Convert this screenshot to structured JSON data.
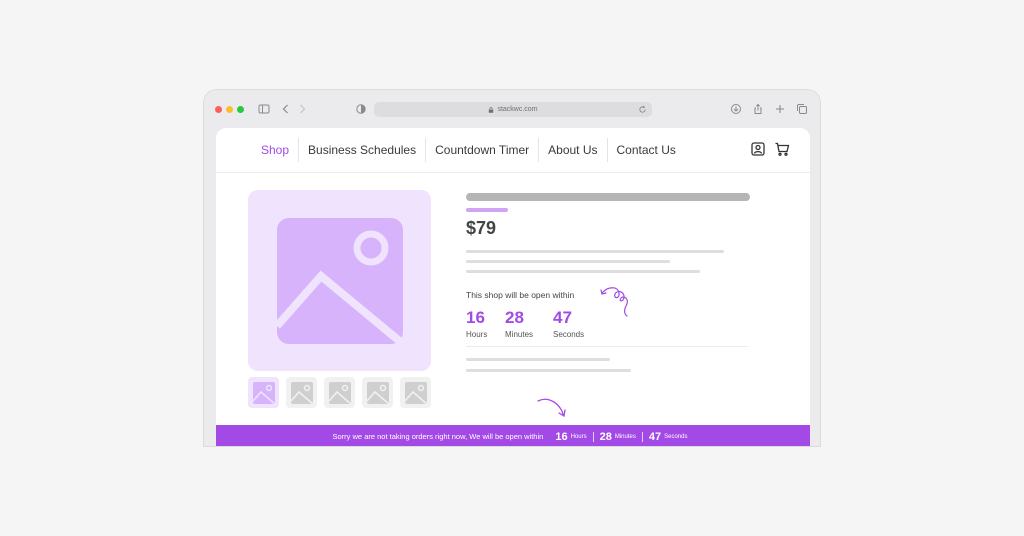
{
  "browser": {
    "url": "stackwc.com"
  },
  "nav": {
    "items": [
      {
        "label": "Shop",
        "active": true
      },
      {
        "label": "Business Schedules",
        "active": false
      },
      {
        "label": "Countdown Timer",
        "active": false
      },
      {
        "label": "About Us",
        "active": false
      },
      {
        "label": "Contact Us",
        "active": false
      }
    ],
    "icons": [
      "account-icon",
      "cart-icon"
    ]
  },
  "product": {
    "price": "$79",
    "open_label": "This shop will be open within",
    "countdown": [
      {
        "value": "16",
        "unit": "Hours"
      },
      {
        "value": "28",
        "unit": "Minutes"
      },
      {
        "value": "47",
        "unit": "Seconds"
      }
    ]
  },
  "banner": {
    "message": "Sorry we are not taking orders right now, We will be open within",
    "countdown": [
      {
        "value": "16",
        "unit": "Hours"
      },
      {
        "value": "28",
        "unit": "Minutes"
      },
      {
        "value": "47",
        "unit": "Seconds"
      }
    ]
  },
  "colors": {
    "accent": "#a34ae6",
    "image_bg": "#efe3fd",
    "image_fg": "#d6b3fb"
  }
}
